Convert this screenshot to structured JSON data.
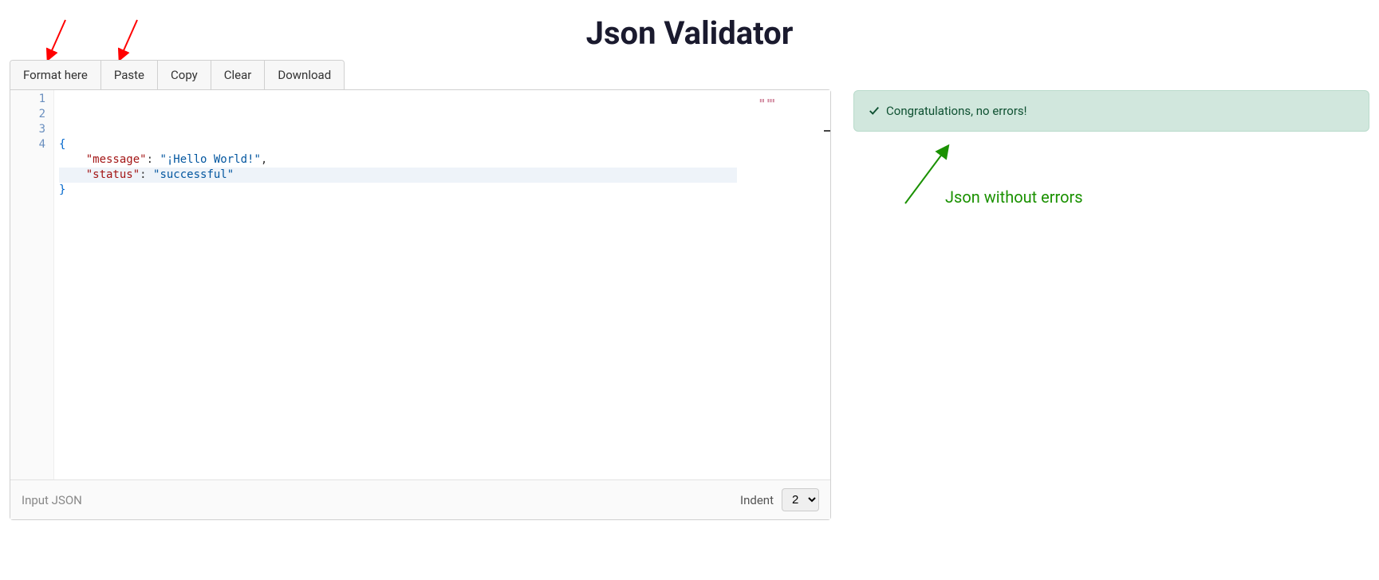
{
  "header": {
    "title": "Json Validator"
  },
  "toolbar": {
    "format_label": "Format here",
    "paste_label": "Paste",
    "copy_label": "Copy",
    "clear_label": "Clear",
    "download_label": "Download"
  },
  "editor": {
    "gutter": [
      "1",
      "2",
      "3",
      "4"
    ],
    "code_lines": [
      {
        "tokens": [
          {
            "t": "brace",
            "v": "{"
          }
        ]
      },
      {
        "tokens": [
          {
            "t": "indent",
            "v": "    "
          },
          {
            "t": "key",
            "v": "\"message\""
          },
          {
            "t": "punc",
            "v": ": "
          },
          {
            "t": "string",
            "v": "\"¡Hello World!\""
          },
          {
            "t": "punc",
            "v": ","
          }
        ]
      },
      {
        "highlight": true,
        "tokens": [
          {
            "t": "indent",
            "v": "    "
          },
          {
            "t": "key",
            "v": "\"status\""
          },
          {
            "t": "punc",
            "v": ": "
          },
          {
            "t": "string",
            "v": "\"successful\""
          }
        ]
      },
      {
        "tokens": [
          {
            "t": "brace",
            "v": "}"
          }
        ]
      }
    ],
    "footer_label": "Input JSON",
    "indent_label": "Indent",
    "indent_value": "2"
  },
  "result": {
    "success_message": "Congratulations, no errors!"
  },
  "annotations": {
    "green_label": "Json without errors"
  }
}
